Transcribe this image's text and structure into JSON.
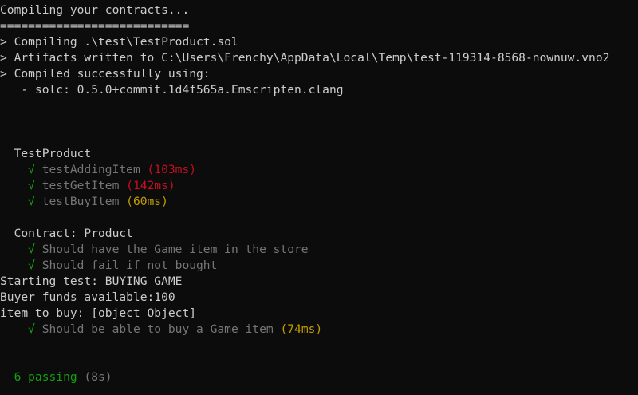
{
  "compile": {
    "header": "Compiling your contracts...",
    "separator": "===========================",
    "line_compiling": "> Compiling .\\test\\TestProduct.sol",
    "line_artifacts": "> Artifacts written to C:\\Users\\Frenchy\\AppData\\Local\\Temp\\test-119314-8568-nownuw.vno2",
    "line_success": "> Compiled successfully using:",
    "line_solc": "   - solc: 0.5.0+commit.1d4f565a.Emscripten.clang"
  },
  "suite1": {
    "title": "  TestProduct",
    "tests": [
      {
        "check": "    √",
        "name": " testAddingItem",
        "duration": " (103ms)"
      },
      {
        "check": "    √",
        "name": " testGetItem",
        "duration": " (142ms)"
      },
      {
        "check": "    √",
        "name": " testBuyItem",
        "duration": " (60ms)"
      }
    ]
  },
  "suite2": {
    "title": "  Contract: Product",
    "tests": [
      {
        "check": "    √",
        "name": " Should have the Game item in the store"
      },
      {
        "check": "    √",
        "name": " Should fail if not bought"
      }
    ],
    "log_lines": [
      "Starting test: BUYING GAME",
      "Buyer funds available:100",
      "item to buy: [object Object]"
    ],
    "last_test": {
      "check": "    √",
      "name": " Should be able to buy a Game item",
      "duration": " (74ms)"
    }
  },
  "summary": {
    "passing": "  6 passing",
    "time": " (8s)"
  },
  "colors": {
    "background": "#0c0c0c",
    "text": "#cccccc",
    "check_green": "#13a10e",
    "dim_gray": "#767676",
    "slow_red": "#c50f1f",
    "medium_yellow": "#c19c00"
  }
}
